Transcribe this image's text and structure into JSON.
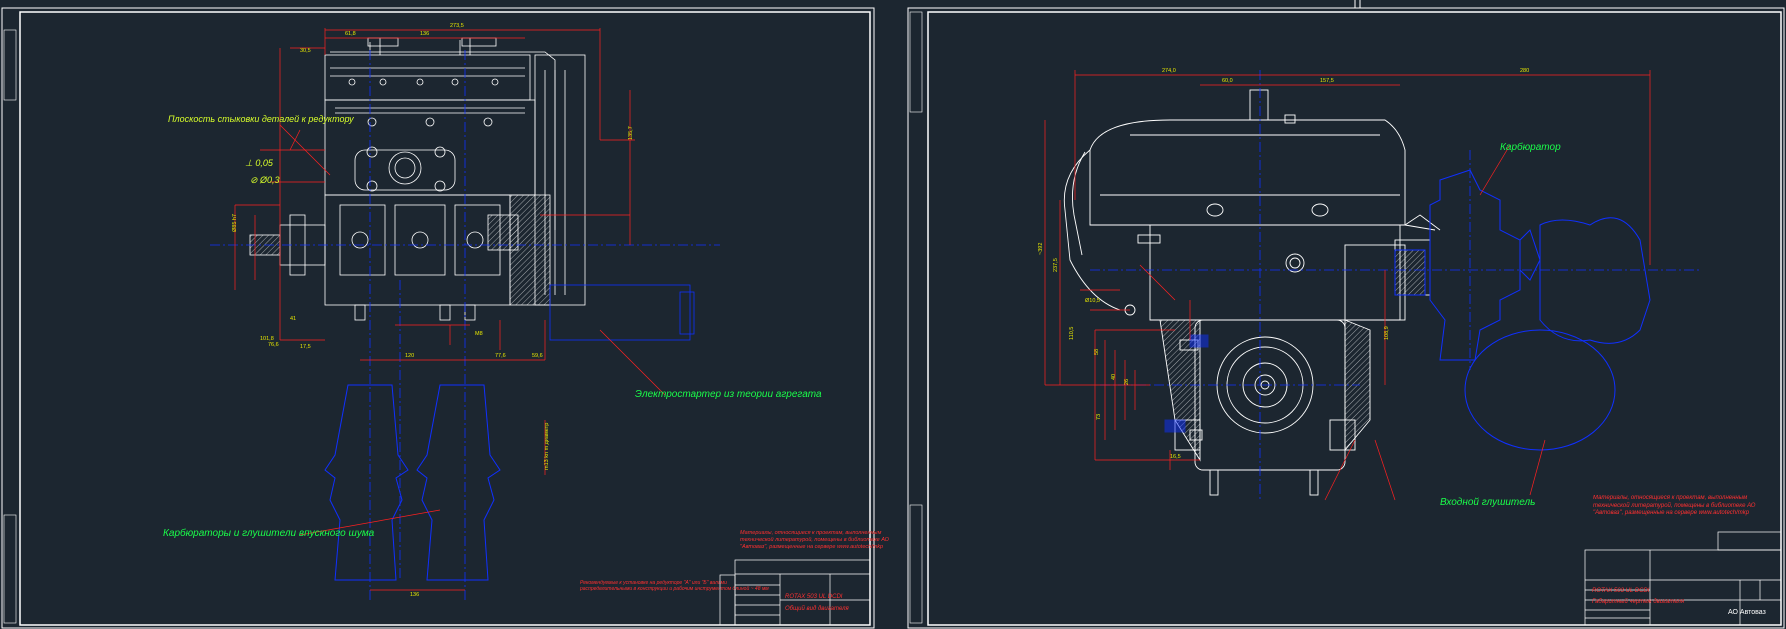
{
  "sheet1": {
    "labels": {
      "shaft_note": "Плоскость стыковки деталей к редуктору",
      "carb_note": "Карбюраторы и глушители впускного шума",
      "electro_note": "Электростартер из теории агрегата",
      "tol1": "⊥ 0,05",
      "tol2": "⊘ Ø0,3",
      "vert_dim": "m13 kn m диаметр"
    },
    "notes": {
      "main": "Материалы, относящиеся к проектам, выполненным технической литературой, помещены в библиотеке АО \"Автоваз\", размещенные на сервере www.autotech/mkp",
      "secondary": "Рекомендуемые к установке на редукторе \"А\" или \"Б\" валами распределительными в конструкции и рабочим инструментом длиной ~ 48 мм"
    },
    "title_block": {
      "code": "ROTAX 503 UL DCDI",
      "desc": "Общий вид двигателя"
    }
  },
  "sheet2": {
    "labels": {
      "carb": "Карбюратор",
      "muffler": "Входной глушитель"
    },
    "notes": {
      "main": "Материалы, относящиеся к проектам, выполненным технической литературой, помещены в библиотеке АО \"Автоваз\", размещенные на сервере www.autotech/mkp"
    },
    "dims": {
      "d1": "274,0",
      "d2": "60,0",
      "d3": "157,5",
      "d4": "280",
      "h1": "~392",
      "h2": "237,5",
      "h3": "110,5",
      "h4": "108,9"
    },
    "title_block": {
      "code": "ROTAX 503 UL DCDI",
      "desc": "Габаритный чертеж двигателя",
      "company": "АО Автоваз"
    }
  },
  "colors": {
    "background": "#1c2630",
    "line": "#ffffff",
    "axis": "#1030ff",
    "dimension": "#ff2020",
    "label_yellow": "#d8ff2a",
    "label_green": "#1aff4a"
  }
}
